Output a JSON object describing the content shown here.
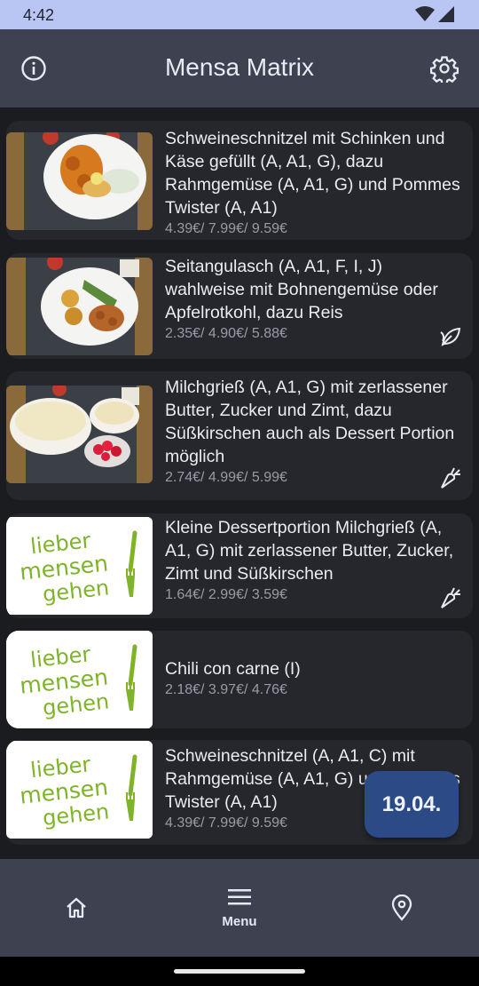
{
  "status": {
    "time": "4:42"
  },
  "app": {
    "title": "Mensa Matrix"
  },
  "meals": [
    {
      "name": "Schweineschnitzel mit Schinken und Käse gefüllt (A, A1, G), dazu Rahmgemüse (A, A1, G) und Pommes Twister (A, A1)",
      "price": "4.39€/ 7.99€/ 9.59€",
      "badge": "",
      "image": "schnitzel-photo"
    },
    {
      "name": "Seitangulasch (A, A1, F, I, J) wahlweise mit Bohnengemüse oder Apfelrotkohl, dazu Reis",
      "price": "2.35€/ 4.90€/ 5.88€",
      "badge": "vegan-leaf-icon",
      "image": "goulash-photo"
    },
    {
      "name": "Milchgrieß (A, A1, G) mit zerlassener Butter, Zucker und Zimt, dazu Süßkirschen auch als Dessert Portion möglich",
      "price": "2.74€/ 4.99€/ 5.99€",
      "badge": "vegetarian-carrot-icon",
      "image": "semolina-photo"
    },
    {
      "name": "Kleine Dessertportion Milchgrieß (A, A1, G) mit zerlassener Butter, Zucker, Zimt und Süßkirschen",
      "price": "1.64€/ 2.99€/ 3.59€",
      "badge": "vegetarian-carrot-icon",
      "image": "placeholder-logo"
    },
    {
      "name": "Chili con carne (I)",
      "price": "2.18€/ 3.97€/ 4.76€",
      "badge": "",
      "image": "placeholder-logo"
    },
    {
      "name": "Schweineschnitzel (A, A1, C) mit Rahmgemüse (A, A1, G) und Pommes Twister (A, A1)",
      "price": "4.39€/ 7.99€/ 9.59€",
      "badge": "",
      "image": "placeholder-logo"
    }
  ],
  "logo": {
    "line1": "lieber",
    "line2": "mensen",
    "line3": "gehen"
  },
  "fab": {
    "label": "19.04."
  },
  "nav": {
    "home_icon": "home-icon",
    "menu_label": "Menu",
    "menu_icon": "menu-icon",
    "location_icon": "location-pin-icon"
  },
  "colors": {
    "appbar": "#3d4150",
    "card": "#26272c",
    "fab": "#2c4a86",
    "logo_green": "#7fb42a"
  }
}
